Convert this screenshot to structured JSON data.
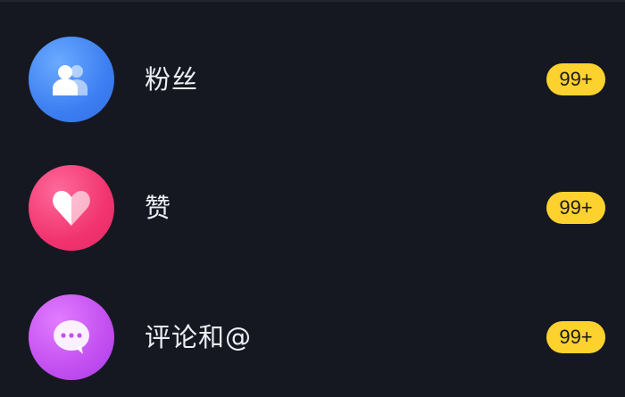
{
  "notifications": {
    "items": [
      {
        "label": "粉丝",
        "badge": "99+",
        "icon": "fans-icon",
        "color": "#3d7ff2"
      },
      {
        "label": "赞",
        "badge": "99+",
        "icon": "heart-icon",
        "color": "#f1346f"
      },
      {
        "label": "评论和@",
        "badge": "99+",
        "icon": "chat-bubble-icon",
        "color": "#c34ff0"
      }
    ],
    "badge_color": "#fdd22f"
  }
}
